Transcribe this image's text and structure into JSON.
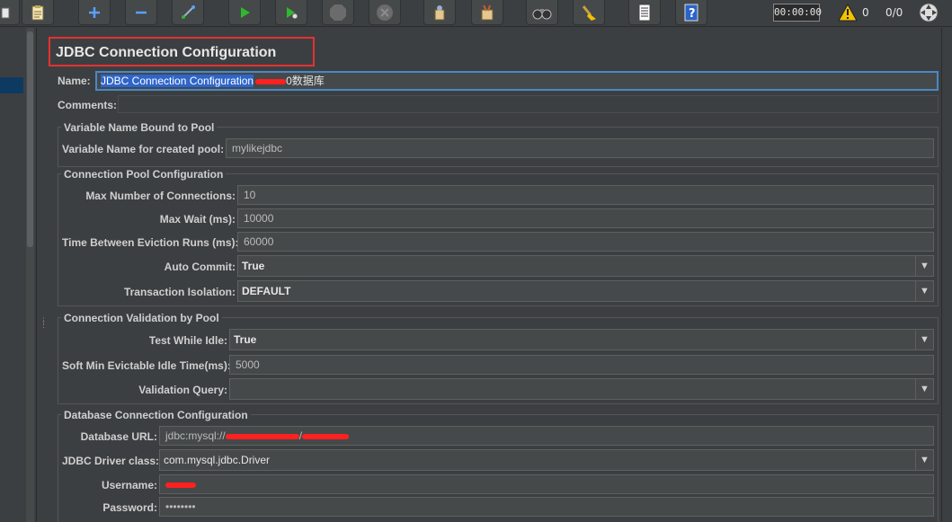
{
  "toolbar": {
    "buttons": [
      {
        "icon": "open-icon"
      },
      {
        "icon": "templates-icon"
      },
      {
        "icon": "expand-all-icon"
      },
      {
        "icon": "collapse-all-icon"
      },
      {
        "icon": "toggle-icon"
      },
      {
        "icon": "start-icon"
      },
      {
        "icon": "start-no-pauses-icon"
      },
      {
        "icon": "stop-icon"
      },
      {
        "icon": "shutdown-icon"
      },
      {
        "icon": "clear-icon"
      },
      {
        "icon": "clear-all-icon"
      },
      {
        "icon": "search-icon"
      },
      {
        "icon": "reset-search-icon"
      },
      {
        "icon": "function-helper-icon"
      },
      {
        "icon": "help-icon"
      }
    ],
    "timer": "00:00:00",
    "warning_count": "0",
    "thread_count": "0/0",
    "colors": {
      "play": "#2fb82f",
      "accent": "#4a88c7",
      "warning": "#f2c200",
      "redaction": "#ff2020"
    }
  },
  "panel": {
    "title": "JDBC Connection Configuration",
    "name_label": "Name:",
    "name_selected": "JDBC Connection Configuration",
    "name_suffix": "0数据库",
    "comments_label": "Comments:",
    "variable_group": {
      "title": "Variable Name Bound to Pool",
      "var_label": "Variable Name for created pool:",
      "var_value": "mylikejdbc"
    },
    "pool_group": {
      "title": "Connection Pool Configuration",
      "max_conn_label": "Max Number of Connections:",
      "max_conn_value": "10",
      "max_wait_label": "Max Wait (ms):",
      "max_wait_value": "10000",
      "eviction_label": "Time Between Eviction Runs (ms):",
      "eviction_value": "60000",
      "auto_commit_label": "Auto Commit:",
      "auto_commit_value": "True",
      "isolation_label": "Transaction Isolation:",
      "isolation_value": "DEFAULT"
    },
    "validation_group": {
      "title": "Connection Validation by Pool",
      "test_idle_label": "Test While Idle:",
      "test_idle_value": "True",
      "soft_min_label": "Soft Min Evictable Idle Time(ms):",
      "soft_min_value": "5000",
      "query_label": "Validation Query:",
      "query_value": ""
    },
    "database_group": {
      "title": "Database Connection Configuration",
      "url_label": "Database URL:",
      "url_prefix": "jdbc:mysql://",
      "url_mid": "/",
      "driver_label": "JDBC Driver class:",
      "driver_value": "com.mysql.jdbc.Driver",
      "username_label": "Username:",
      "username_value": "",
      "password_label": "Password:",
      "password_value": "••••••••"
    }
  }
}
